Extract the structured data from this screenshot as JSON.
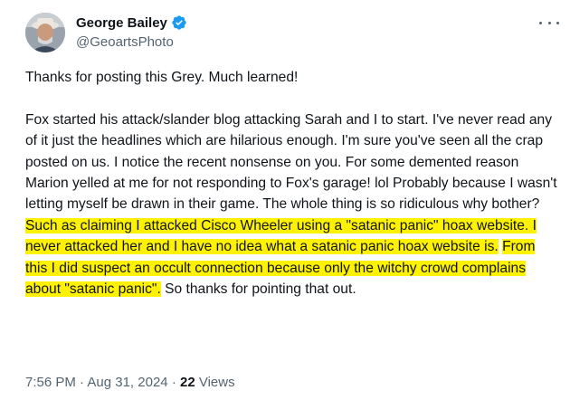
{
  "author": {
    "display_name": "George Bailey",
    "handle": "@GeoartsPhoto"
  },
  "tweet": {
    "paragraph1": "Thanks for posting this Grey.  Much learned!",
    "paragraph2_plain": "Fox started his attack/slander blog attacking Sarah and I to start.  I've never read any of it just the headlines which are hilarious enough.  I'm sure you've seen all the crap posted on us. I notice the recent nonsense on you.  For some demented reason Marion yelled at me for not responding to Fox's garage!  lol  Probably because I wasn't letting myself be drawn in their game.  The whole thing is so ridiculous why bother?",
    "highlight1": "Such as claiming I attacked Cisco Wheeler using a \"satanic panic\" hoax website.  I never attacked her and I have no idea what a satanic panic hoax website is.",
    "highlight2": "From this I did suspect an occult connection because only the witchy crowd complains about \"satanic panic\".",
    "tail": "So thanks for pointing that out.",
    "time": "7:56 PM",
    "date": "Aug 31, 2024",
    "views_count": "22",
    "views_label": "Views"
  },
  "colors": {
    "highlight": "#fff200",
    "verified_badge": "#1d9bf0",
    "secondary_text": "#536471"
  },
  "icons": {
    "verified": "verified-badge-icon",
    "more": "more-options-icon"
  }
}
